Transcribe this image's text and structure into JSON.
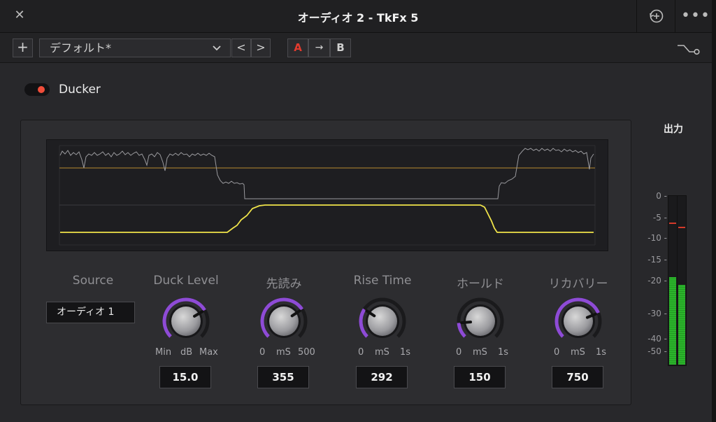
{
  "window": {
    "title": "オーディオ 2 - TkFx 5"
  },
  "toolbar": {
    "add_label": "+",
    "preset_name": "デフォルト*",
    "prev_label": "<",
    "next_label": ">",
    "ab_a_label": "A",
    "ab_copy_label": "→",
    "ab_b_label": "B"
  },
  "plugin": {
    "name": "Ducker",
    "enabled": true
  },
  "source": {
    "label": "Source",
    "value": "オーディオ 1"
  },
  "knobs": [
    {
      "label": "Duck Level",
      "min_label": "Min",
      "unit": "dB",
      "max_label": "Max",
      "value": "15.0",
      "fraction": 0.72
    },
    {
      "label": "先読み",
      "min_label": "0",
      "unit": "mS",
      "max_label": "500",
      "value": "355",
      "fraction": 0.71
    },
    {
      "label": "Rise Time",
      "min_label": "0",
      "unit": "mS",
      "max_label": "1s",
      "value": "292",
      "fraction": 0.29
    },
    {
      "label": "ホールド",
      "min_label": "0",
      "unit": "mS",
      "max_label": "1s",
      "value": "150",
      "fraction": 0.15
    },
    {
      "label": "リカバリー",
      "min_label": "0",
      "unit": "mS",
      "max_label": "1s",
      "value": "750",
      "fraction": 0.75
    }
  ],
  "meter": {
    "title": "出力",
    "scale": [
      "0",
      "-5",
      "-10",
      "-15",
      "-20",
      "-30",
      "-40",
      "-50"
    ],
    "left_level_db": -19,
    "right_level_db": -21,
    "left_peak_db": -6,
    "right_peak_db": -7
  },
  "colors": {
    "accent_purple": "#8e4bd6",
    "gain_curve": "#f0e44a",
    "threshold_line": "#b8892e",
    "meter_green": "#2bb52b",
    "toggle_on": "#f04d3a",
    "ab_active": "#e33b2e"
  },
  "icons": {
    "close": "close-icon",
    "reset": "reset-history-icon",
    "more": "more-options-icon",
    "bypass": "bypass-curve-icon",
    "dropdown": "chevron-down-icon"
  }
}
